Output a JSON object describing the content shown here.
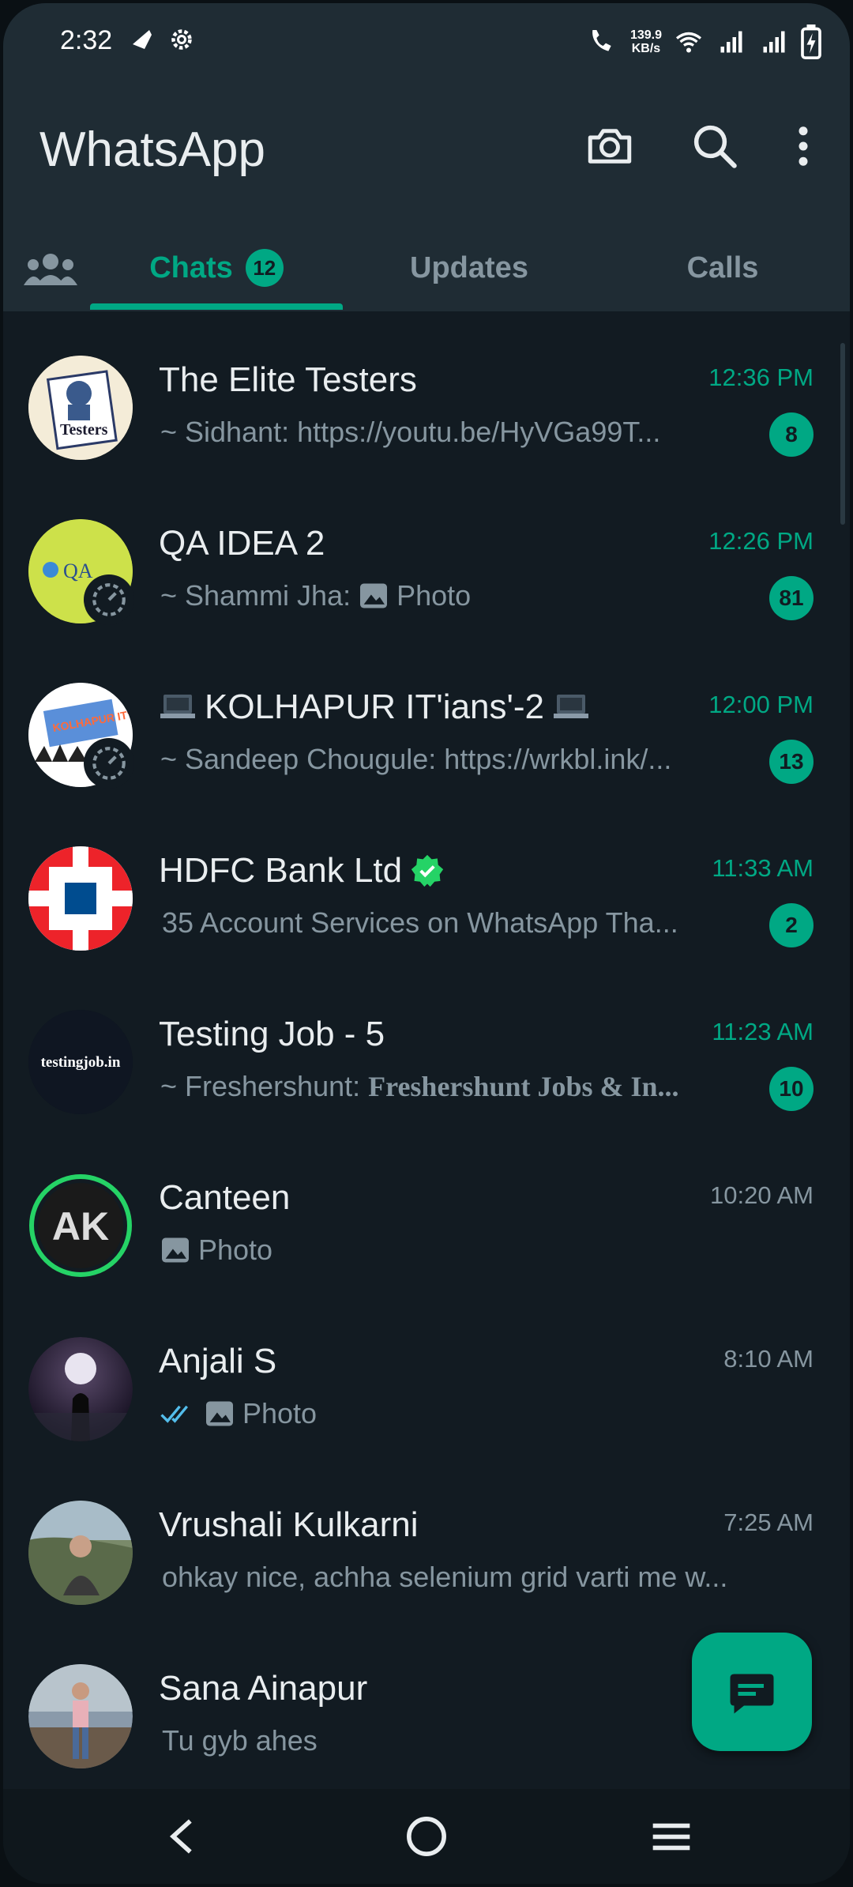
{
  "status_bar": {
    "time": "2:32",
    "net_speed_top": "139.9",
    "net_speed_bottom": "KB/s"
  },
  "app_bar": {
    "title": "WhatsApp"
  },
  "tabs": [
    {
      "label": "Chats",
      "badge": "12"
    },
    {
      "label": "Updates"
    },
    {
      "label": "Calls"
    }
  ],
  "chats": [
    {
      "name": "The Elite Testers",
      "time": "12:36 PM",
      "preview": "~ Sidhant: https://youtu.be/HyVGa99T...",
      "unread": "8"
    },
    {
      "name": "QA IDEA 2",
      "time": "12:26 PM",
      "preview_sender": "~ Shammi Jha:",
      "preview": "Photo",
      "unread": "81"
    },
    {
      "name": "KOLHAPUR IT'ians'-2",
      "time": "12:00 PM",
      "preview": "~ Sandeep Chougule: https://wrkbl.ink/...",
      "unread": "13"
    },
    {
      "name": "HDFC Bank Ltd",
      "time": "11:33 AM",
      "preview": "35 Account Services on WhatsApp  Tha...",
      "unread": "2"
    },
    {
      "name": "Testing Job - 5",
      "time": "11:23 AM",
      "preview_sender": "~ Freshershunt:",
      "preview": "Freshershunt Jobs & In...",
      "unread": "10"
    },
    {
      "name": "Canteen",
      "time": "10:20 AM",
      "preview": "Photo"
    },
    {
      "name": "Anjali S",
      "time": "8:10 AM",
      "preview": "Photo"
    },
    {
      "name": "Vrushali Kulkarni",
      "time": "7:25 AM",
      "preview": "ohkay nice, achha selenium grid varti me w..."
    },
    {
      "name": "Sana Ainapur",
      "time": "",
      "preview": "Tu gyb ahes"
    }
  ],
  "avatar_texts": {
    "elite": "Testers",
    "qa": "QA",
    "kolhapur": "KOLHAPUR IT'ians'",
    "testingjob": "testingjob.in",
    "canteen": "AK"
  },
  "colors": {
    "accent": "#00a884",
    "header_bg": "#1f2c34",
    "list_bg": "#121b22",
    "verified": "#25d366"
  }
}
